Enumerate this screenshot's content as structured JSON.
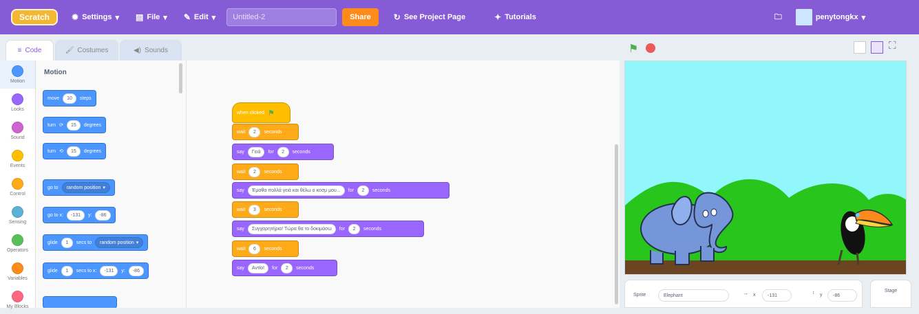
{
  "menubar": {
    "logo": "Scratch",
    "settings": "Settings",
    "file": "File",
    "edit": "Edit",
    "project_title": "Untitled-2",
    "share": "Share",
    "see_project_page": "See Project Page",
    "tutorials": "Tutorials",
    "username": "penytongkx"
  },
  "tabs": {
    "code": "Code",
    "costumes": "Costumes",
    "sounds": "Sounds"
  },
  "categories": [
    {
      "label": "Motion",
      "color": "#4c97ff"
    },
    {
      "label": "Looks",
      "color": "#9966ff"
    },
    {
      "label": "Sound",
      "color": "#cf63cf"
    },
    {
      "label": "Events",
      "color": "#ffbf00"
    },
    {
      "label": "Control",
      "color": "#ffab19"
    },
    {
      "label": "Sensing",
      "color": "#5cb1d6"
    },
    {
      "label": "Operators",
      "color": "#59c059"
    },
    {
      "label": "Variables",
      "color": "#ff8c1a"
    },
    {
      "label": "My Blocks",
      "color": "#ff6680"
    }
  ],
  "palette": {
    "heading": "Motion",
    "move": {
      "text1": "move",
      "value": "10",
      "text2": "steps"
    },
    "turn_right": {
      "text1": "turn",
      "value": "15",
      "text2": "degrees"
    },
    "turn_left": {
      "text1": "turn",
      "value": "15",
      "text2": "degrees"
    },
    "goto_random": {
      "text": "go to",
      "option": "random position"
    },
    "goto_xy": {
      "text": "go to x:",
      "x": "-131",
      "text_y": "y:",
      "y": "-86"
    },
    "glide_random": {
      "text1": "glide",
      "secs": "1",
      "text2": "secs to",
      "option": "random position"
    },
    "glide_xy": {
      "text1": "glide",
      "secs": "1",
      "text2": "secs to x:",
      "x": "-131",
      "text_y": "y:",
      "y": "-86"
    }
  },
  "script": {
    "when_flag": "when clicked",
    "wait1": {
      "text": "wait",
      "value": "2",
      "suffix": "seconds"
    },
    "say1": {
      "text": "say",
      "message": "Γειά",
      "mid": "for",
      "value": "2",
      "suffix": "seconds"
    },
    "wait2": {
      "text": "wait",
      "value": "2",
      "suffix": "seconds"
    },
    "say2": {
      "text": "say",
      "message": "Έμαθα πολλά γειά και θέλω ο κοσμ μου...",
      "mid": "for",
      "value": "2",
      "suffix": "seconds"
    },
    "wait3": {
      "text": "wait",
      "value": "3",
      "suffix": "seconds"
    },
    "say3": {
      "text": "say",
      "message": "Συγχαρητήρια! Τώρα θα το δοκιμάσω",
      "mid": "for",
      "value": "2",
      "suffix": "seconds"
    },
    "wait4": {
      "text": "wait",
      "value": "6",
      "suffix": "seconds"
    },
    "say4": {
      "text": "say",
      "message": "Αντίο!",
      "mid": "for",
      "value": "2",
      "suffix": "seconds"
    }
  },
  "sprite_info": {
    "sprite_label": "Sprite",
    "sprite_name": "Elephant",
    "x_label": "x",
    "x_value": "-131",
    "y_label": "y",
    "y_value": "-86"
  },
  "stage_label": "Stage",
  "colors": {
    "brand": "#855cd6",
    "motion": "#4c97ff",
    "looks": "#9966ff",
    "control": "#ffab19",
    "events": "#ffbf00"
  }
}
